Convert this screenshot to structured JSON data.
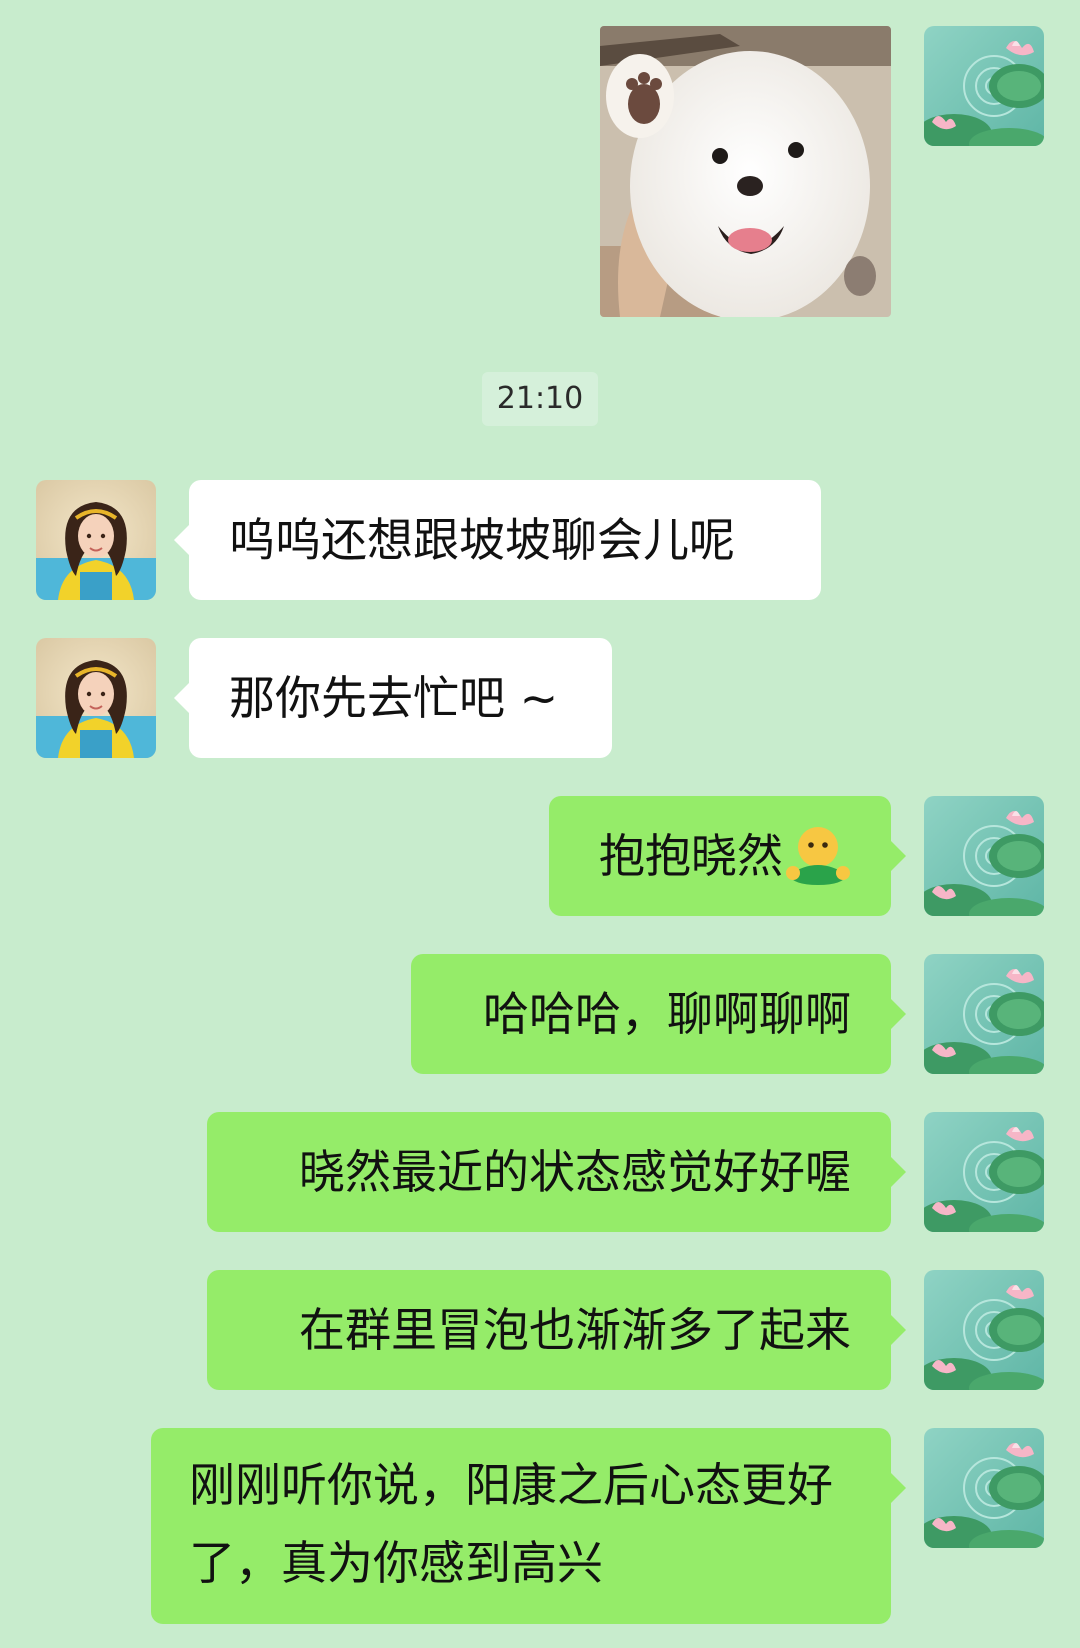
{
  "chat": {
    "timestamp": "21:10",
    "messages": [
      {
        "sender": "incoming",
        "text": "呜呜还想跟坡坡聊会儿呢"
      },
      {
        "sender": "incoming",
        "text": "那你先去忙吧 ~"
      },
      {
        "sender": "outgoing",
        "text": "抱抱晓然",
        "emoji": "hug-emoji"
      },
      {
        "sender": "outgoing",
        "text": "哈哈哈，聊啊聊啊"
      },
      {
        "sender": "outgoing",
        "text": "晓然最近的状态感觉好好喔"
      },
      {
        "sender": "outgoing",
        "text": "在群里冒泡也渐渐多了起来"
      },
      {
        "sender": "outgoing",
        "text": "刚刚听你说，阳康之后心态更好了，真为你感到高兴"
      }
    ]
  },
  "colors": {
    "background": "#c8eccd",
    "incoming_bubble": "#ffffff",
    "outgoing_bubble": "#95ec69",
    "timestamp_bg": "#d5f0da"
  },
  "icons": {
    "self_avatar": "lotus-pond-avatar",
    "contact_avatar": "girl-portrait-avatar",
    "sent_image": "white-pomeranian-sticker"
  }
}
